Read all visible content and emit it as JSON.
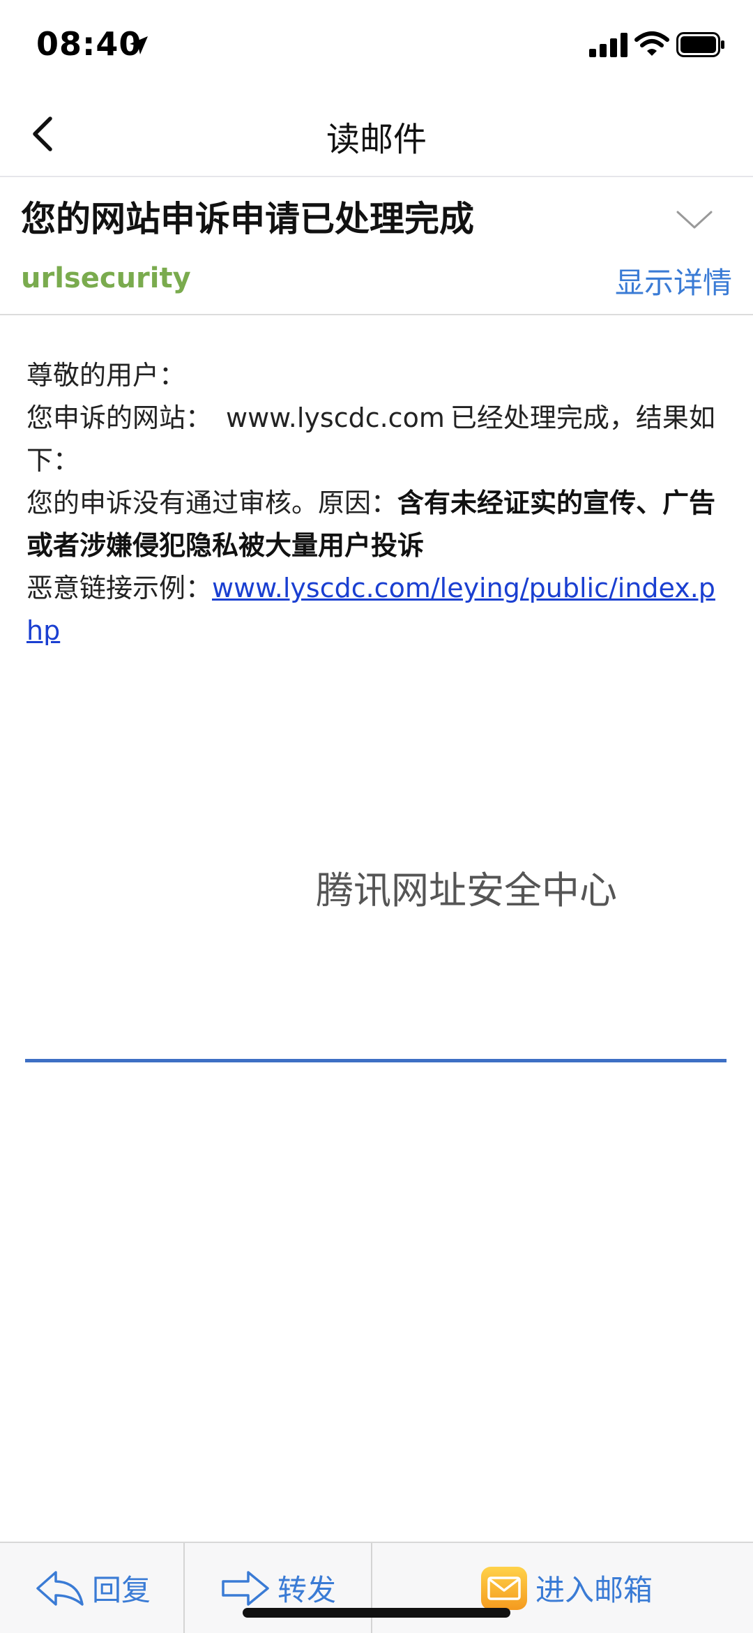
{
  "status_bar": {
    "time": "08:40"
  },
  "nav": {
    "title": "读邮件"
  },
  "mail": {
    "subject": "您的网站申诉申请已处理完成",
    "sender": "urlsecurity",
    "show_details": "显示详情",
    "greeting": "尊敬的用户：",
    "line1_prefix": "您申诉的网站：",
    "line1_url": "www.lyscdc.com",
    "line1_suffix": "已经处理完成，结果如下：",
    "line2_prefix": "您的申诉没有通过审核。原因：",
    "line2_reason": "含有未经证实的宣传、广告或者涉嫌侵犯隐私被大量用户投诉",
    "line3_prefix": "恶意链接示例：",
    "line3_link": "www.lyscdc.com/leying/public/index.php",
    "org_name": "腾讯网址安全中心"
  },
  "toolbar": {
    "reply": "回复",
    "forward": "转发",
    "inbox": "进入邮箱"
  },
  "colors": {
    "accent": "#3a7bd5",
    "sender": "#7aab4e",
    "link": "#1a3fd1",
    "divider": "#3d6fc4"
  }
}
